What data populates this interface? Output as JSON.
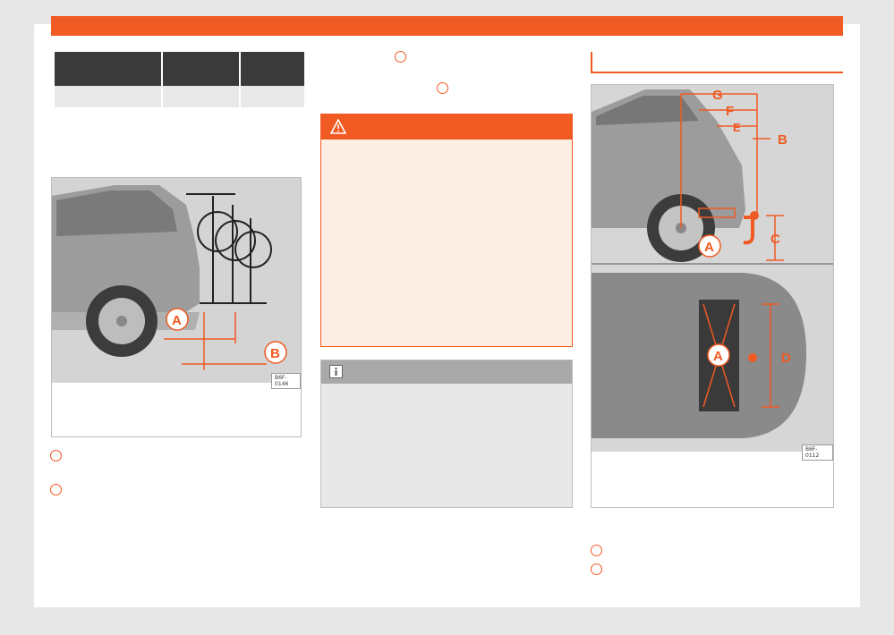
{
  "figures": {
    "figure_1": {
      "code": "B6F-0146",
      "callouts": [
        "A",
        "B"
      ]
    },
    "figure_2": {
      "code": "B6F-0112",
      "callouts": [
        "G",
        "F",
        "E",
        "B",
        "C",
        "A",
        "A",
        "D"
      ]
    }
  },
  "colors": {
    "accent": "#f05a23",
    "table_header": "#3a3a3a",
    "warning_bg": "#fdeee3",
    "info_bg": "#e8e8e8"
  },
  "icons": {
    "warning": "warning-triangle-icon",
    "info": "info-icon"
  }
}
